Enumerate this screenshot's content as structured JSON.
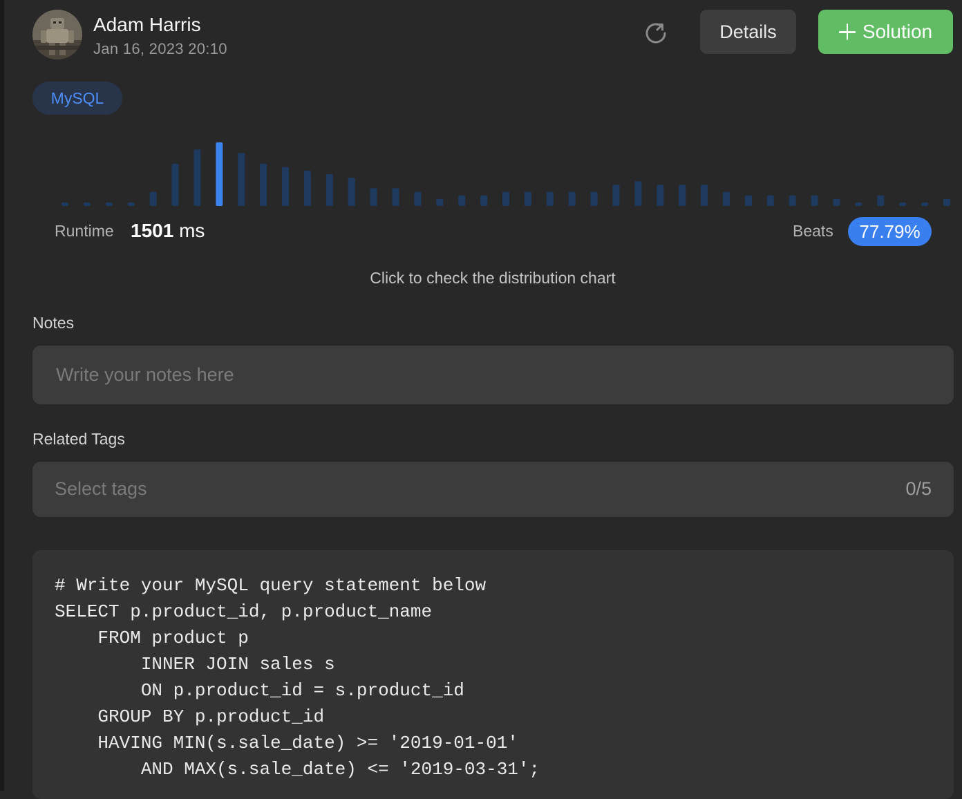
{
  "header": {
    "user_name": "Adam Harris",
    "post_date": "Jan 16, 2023 20:10",
    "details_label": "Details",
    "solution_label": "Solution"
  },
  "language_badge": "MySQL",
  "runtime": {
    "label": "Runtime",
    "value": "1501",
    "unit": "ms"
  },
  "beats": {
    "label": "Beats",
    "value": "77.79%"
  },
  "chart_hint": "Click to check the distribution chart",
  "chart_data": {
    "type": "bar",
    "values": [
      1,
      1,
      1,
      1,
      4,
      12,
      16,
      18,
      15,
      12,
      11,
      10,
      9,
      8,
      5,
      5,
      4,
      2,
      3,
      3,
      4,
      4,
      4,
      4,
      4,
      6,
      7,
      6,
      6,
      6,
      4,
      3,
      3,
      3,
      3,
      2,
      1,
      3,
      1,
      1,
      2
    ],
    "highlight_index": 7,
    "colors": {
      "bar": "#1f3a5f",
      "highlight": "#3d83f0"
    }
  },
  "notes": {
    "label": "Notes",
    "placeholder": "Write your notes here"
  },
  "related_tags": {
    "label": "Related Tags",
    "placeholder": "Select tags",
    "count": "0/5"
  },
  "code": {
    "lines": [
      "# Write your MySQL query statement below",
      "SELECT p.product_id, p.product_name",
      "    FROM product p",
      "        INNER JOIN sales s",
      "        ON p.product_id = s.product_id",
      "    GROUP BY p.product_id",
      "    HAVING MIN(s.sale_date) >= '2019-01-01'",
      "        AND MAX(s.sale_date) <= '2019-03-31';"
    ]
  },
  "icons": {
    "refresh": "refresh-icon",
    "plus": "plus-icon"
  }
}
